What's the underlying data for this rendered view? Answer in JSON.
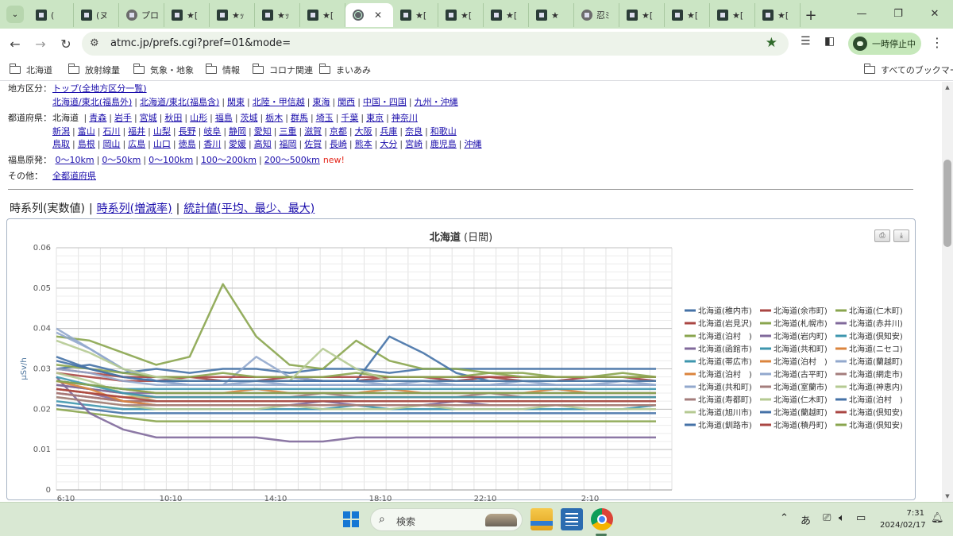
{
  "browser": {
    "tabs": [
      {
        "label": "(",
        "icon": "site-favicon"
      },
      {
        "label": "(ヌ",
        "icon": "site-favicon"
      },
      {
        "label": "プロ",
        "icon": "site-favicon"
      },
      {
        "label": "★[",
        "icon": "site-favicon"
      },
      {
        "label": "★ｯ",
        "icon": "site-favicon"
      },
      {
        "label": "★ｯ",
        "icon": "site-favicon"
      },
      {
        "label": "★[",
        "icon": "site-favicon"
      },
      {
        "label": "",
        "icon": "globe-icon",
        "active": true
      },
      {
        "label": "★[",
        "icon": "site-favicon"
      },
      {
        "label": "★[",
        "icon": "site-favicon"
      },
      {
        "label": "★[",
        "icon": "site-favicon"
      },
      {
        "label": "★",
        "icon": "site-favicon"
      },
      {
        "label": "忍ﾐ",
        "icon": "site-favicon"
      },
      {
        "label": "★[",
        "icon": "site-favicon"
      },
      {
        "label": "★[",
        "icon": "site-favicon"
      },
      {
        "label": "★[",
        "icon": "site-favicon"
      },
      {
        "label": "★[",
        "icon": "site-favicon"
      }
    ],
    "url": "atmc.jp/prefs.cgi?pref=01&mode=",
    "pause_label": "一時停止中",
    "bookmarks": [
      "北海道",
      "放射線量",
      "気象・地象",
      "情報",
      "コロナ関連",
      "まいあみ"
    ],
    "all_bookmarks": "すべてのブックマーク"
  },
  "nav": {
    "region_label": "地方区分：",
    "region_top": "トップ(全地方区分一覧)",
    "regions": [
      "北海道/東北(福島外)",
      "北海道/東北(福島含)",
      "関東",
      "北陸・甲信越",
      "東海",
      "関西",
      "中国・四国",
      "九州・沖縄"
    ],
    "pref_label": "都道府県：",
    "pref_current": "北海道",
    "prefs_row1": [
      "青森",
      "岩手",
      "宮城",
      "秋田",
      "山形",
      "福島",
      "茨城",
      "栃木",
      "群馬",
      "埼玉",
      "千葉",
      "東京",
      "神奈川"
    ],
    "prefs_row2": [
      "新潟",
      "富山",
      "石川",
      "福井",
      "山梨",
      "長野",
      "岐阜",
      "静岡",
      "愛知",
      "三重",
      "滋賀",
      "京都",
      "大阪",
      "兵庫",
      "奈良",
      "和歌山"
    ],
    "prefs_row3": [
      "鳥取",
      "島根",
      "岡山",
      "広島",
      "山口",
      "徳島",
      "香川",
      "愛媛",
      "高知",
      "福岡",
      "佐賀",
      "長崎",
      "熊本",
      "大分",
      "宮崎",
      "鹿児島",
      "沖縄"
    ],
    "fukushima_label": "福島原発：",
    "fukushima": [
      "0～10km",
      "0～50km",
      "0～100km",
      "100～200km",
      "200～500km"
    ],
    "new_badge": "new!",
    "other_label": "その他：",
    "other": "全都道府県"
  },
  "modes": {
    "current": "時系列(実数値)",
    "links": [
      "時系列(増減率)",
      "統計値(平均、最少、最大)"
    ]
  },
  "chart_data": {
    "type": "line",
    "title": "北海道",
    "subtitle": "(日間)",
    "ylabel": "μSv/h",
    "ylim": [
      0,
      0.06
    ],
    "yticks": [
      "0",
      "0.01",
      "0.02",
      "0.03",
      "0.04",
      "0.05",
      "0.06"
    ],
    "xticks": [
      "6:10",
      "10:10",
      "14:10",
      "18:10",
      "22:10",
      "2:10"
    ],
    "grid": true,
    "legend_position": "right",
    "colors": [
      "#4572A7",
      "#AA4643",
      "#89A54E",
      "#80699B",
      "#3D96AE",
      "#DB843D",
      "#92A8CD",
      "#A47D7C",
      "#B5CA92"
    ],
    "series": [
      {
        "name": "北海道(稚内市)",
        "values": [
          0.03,
          0.031,
          0.029,
          0.03,
          0.029,
          0.03,
          0.03,
          0.029,
          0.03,
          0.03,
          0.029,
          0.03,
          0.03,
          0.03,
          0.03,
          0.03,
          0.03,
          0.03,
          0.03
        ]
      },
      {
        "name": "北海道(岩見沢)",
        "values": [
          0.029,
          0.028,
          0.027,
          0.027,
          0.028,
          0.027,
          0.027,
          0.028,
          0.027,
          0.027,
          0.028,
          0.028,
          0.027,
          0.028,
          0.027,
          0.027,
          0.028,
          0.028,
          0.027
        ]
      },
      {
        "name": "北海道(泊村　)",
        "values": [
          0.038,
          0.037,
          0.034,
          0.031,
          0.033,
          0.051,
          0.038,
          0.031,
          0.03,
          0.037,
          0.032,
          0.03,
          0.03,
          0.029,
          0.029,
          0.028,
          0.028,
          0.029,
          0.028
        ]
      },
      {
        "name": "北海道(函館市)",
        "values": [
          0.025,
          0.024,
          0.022,
          0.021,
          0.021,
          0.021,
          0.021,
          0.021,
          0.022,
          0.021,
          0.021,
          0.021,
          0.022,
          0.021,
          0.021,
          0.021,
          0.021,
          0.021,
          0.021
        ]
      },
      {
        "name": "北海道(帯広市)",
        "values": [
          0.022,
          0.021,
          0.02,
          0.02,
          0.02,
          0.02,
          0.02,
          0.02,
          0.02,
          0.021,
          0.02,
          0.02,
          0.02,
          0.02,
          0.02,
          0.02,
          0.02,
          0.02,
          0.021
        ]
      },
      {
        "name": "北海道(泊村　)",
        "values": [
          0.027,
          0.026,
          0.025,
          0.024,
          0.024,
          0.024,
          0.025,
          0.024,
          0.024,
          0.024,
          0.025,
          0.024,
          0.024,
          0.024,
          0.024,
          0.025,
          0.024,
          0.024,
          0.024
        ]
      },
      {
        "name": "北海道(共和町)",
        "values": [
          0.04,
          0.035,
          0.03,
          0.027,
          0.026,
          0.026,
          0.033,
          0.028,
          0.027,
          0.027,
          0.026,
          0.027,
          0.026,
          0.026,
          0.027,
          0.026,
          0.026,
          0.027,
          0.026
        ]
      },
      {
        "name": "北海道(寿都町)",
        "values": [
          0.026,
          0.025,
          0.024,
          0.023,
          0.023,
          0.023,
          0.023,
          0.023,
          0.024,
          0.023,
          0.023,
          0.023,
          0.023,
          0.024,
          0.023,
          0.023,
          0.023,
          0.023,
          0.023
        ]
      },
      {
        "name": "北海道(旭川市)",
        "values": [
          0.023,
          0.022,
          0.021,
          0.02,
          0.02,
          0.02,
          0.02,
          0.021,
          0.02,
          0.02,
          0.02,
          0.021,
          0.02,
          0.02,
          0.02,
          0.021,
          0.02,
          0.02,
          0.02
        ]
      },
      {
        "name": "北海道(釧路市)",
        "values": [
          0.021,
          0.02,
          0.019,
          0.019,
          0.019,
          0.019,
          0.019,
          0.019,
          0.019,
          0.019,
          0.019,
          0.019,
          0.019,
          0.019,
          0.019,
          0.019,
          0.019,
          0.019,
          0.019
        ]
      },
      {
        "name": "北海道(余市町)",
        "values": [
          0.024,
          0.023,
          0.022,
          0.022,
          0.022,
          0.022,
          0.022,
          0.022,
          0.022,
          0.022,
          0.022,
          0.022,
          0.022,
          0.022,
          0.022,
          0.022,
          0.022,
          0.022,
          0.022
        ]
      },
      {
        "name": "北海道(札幌市)",
        "values": [
          0.02,
          0.019,
          0.018,
          0.017,
          0.017,
          0.017,
          0.017,
          0.017,
          0.017,
          0.017,
          0.017,
          0.017,
          0.017,
          0.017,
          0.017,
          0.017,
          0.017,
          0.017,
          0.017
        ]
      },
      {
        "name": "北海道(岩内町)",
        "values": [
          0.028,
          0.019,
          0.015,
          0.013,
          0.013,
          0.013,
          0.013,
          0.012,
          0.012,
          0.013,
          0.013,
          0.013,
          0.013,
          0.013,
          0.013,
          0.013,
          0.013,
          0.013,
          0.013
        ]
      },
      {
        "name": "北海道(共和町)",
        "values": [
          0.027,
          0.026,
          0.025,
          0.025,
          0.025,
          0.025,
          0.025,
          0.025,
          0.025,
          0.025,
          0.025,
          0.025,
          0.025,
          0.025,
          0.025,
          0.025,
          0.025,
          0.025,
          0.025
        ]
      },
      {
        "name": "北海道(泊村　)",
        "values": [
          0.025,
          0.024,
          0.023,
          0.023,
          0.023,
          0.023,
          0.023,
          0.023,
          0.023,
          0.023,
          0.023,
          0.023,
          0.023,
          0.023,
          0.023,
          0.023,
          0.023,
          0.023,
          0.023
        ]
      },
      {
        "name": "北海道(古平町)",
        "values": [
          0.039,
          0.035,
          0.03,
          0.027,
          0.026,
          0.026,
          0.027,
          0.026,
          0.026,
          0.026,
          0.026,
          0.026,
          0.026,
          0.026,
          0.026,
          0.026,
          0.026,
          0.026,
          0.026
        ]
      },
      {
        "name": "北海道(室蘭市)",
        "values": [
          0.024,
          0.023,
          0.022,
          0.022,
          0.022,
          0.022,
          0.022,
          0.022,
          0.022,
          0.022,
          0.022,
          0.022,
          0.022,
          0.022,
          0.022,
          0.022,
          0.022,
          0.022,
          0.022
        ]
      },
      {
        "name": "北海道(仁木町)",
        "values": [
          0.029,
          0.027,
          0.024,
          0.022,
          0.022,
          0.022,
          0.022,
          0.022,
          0.022,
          0.022,
          0.022,
          0.022,
          0.022,
          0.022,
          0.022,
          0.022,
          0.022,
          0.022,
          0.022
        ]
      },
      {
        "name": "北海道(蘭越町)",
        "values": [
          0.033,
          0.03,
          0.028,
          0.027,
          0.027,
          0.027,
          0.027,
          0.027,
          0.027,
          0.027,
          0.038,
          0.034,
          0.029,
          0.027,
          0.027,
          0.027,
          0.027,
          0.027,
          0.027
        ]
      },
      {
        "name": "北海道(積丹町)",
        "values": [
          0.03,
          0.029,
          0.028,
          0.028,
          0.028,
          0.028,
          0.028,
          0.028,
          0.028,
          0.028,
          0.028,
          0.028,
          0.028,
          0.028,
          0.028,
          0.028,
          0.028,
          0.028,
          0.028
        ]
      },
      {
        "name": "北海道(仁木町)",
        "values": [
          0.031,
          0.03,
          0.029,
          0.028,
          0.028,
          0.029,
          0.028,
          0.028,
          0.028,
          0.029,
          0.028,
          0.028,
          0.028,
          0.029,
          0.028,
          0.028,
          0.028,
          0.028,
          0.028
        ]
      },
      {
        "name": "北海道(赤井川)",
        "values": [
          0.026,
          0.025,
          0.024,
          0.024,
          0.024,
          0.024,
          0.024,
          0.024,
          0.024,
          0.024,
          0.024,
          0.024,
          0.024,
          0.024,
          0.024,
          0.024,
          0.024,
          0.024,
          0.024
        ]
      },
      {
        "name": "北海道(倶知安)",
        "values": [
          0.028,
          0.026,
          0.024,
          0.023,
          0.023,
          0.023,
          0.023,
          0.023,
          0.023,
          0.023,
          0.023,
          0.023,
          0.023,
          0.023,
          0.023,
          0.023,
          0.023,
          0.023,
          0.023
        ]
      },
      {
        "name": "北海道(ニセコ)",
        "values": [
          0.027,
          0.025,
          0.022,
          0.021,
          0.021,
          0.021,
          0.021,
          0.021,
          0.021,
          0.021,
          0.021,
          0.021,
          0.021,
          0.021,
          0.021,
          0.021,
          0.021,
          0.021,
          0.021
        ]
      },
      {
        "name": "北海道(蘭越町)",
        "values": [
          0.03,
          0.029,
          0.027,
          0.026,
          0.026,
          0.026,
          0.026,
          0.026,
          0.026,
          0.026,
          0.026,
          0.026,
          0.026,
          0.026,
          0.026,
          0.026,
          0.026,
          0.026,
          0.026
        ]
      },
      {
        "name": "北海道(網走市)",
        "values": [
          0.023,
          0.022,
          0.021,
          0.021,
          0.021,
          0.021,
          0.021,
          0.021,
          0.021,
          0.021,
          0.021,
          0.021,
          0.021,
          0.021,
          0.021,
          0.021,
          0.021,
          0.021,
          0.021
        ]
      },
      {
        "name": "北海道(神恵内)",
        "values": [
          0.037,
          0.034,
          0.03,
          0.028,
          0.027,
          0.027,
          0.027,
          0.027,
          0.035,
          0.03,
          0.027,
          0.027,
          0.027,
          0.027,
          0.027,
          0.027,
          0.027,
          0.027,
          0.027
        ]
      },
      {
        "name": "北海道(泊村　)",
        "values": [
          0.032,
          0.03,
          0.028,
          0.027,
          0.027,
          0.027,
          0.027,
          0.027,
          0.027,
          0.027,
          0.027,
          0.027,
          0.027,
          0.027,
          0.027,
          0.027,
          0.027,
          0.027,
          0.027
        ]
      },
      {
        "name": "北海道(倶知安)",
        "values": [
          0.025,
          0.024,
          0.023,
          0.022,
          0.022,
          0.022,
          0.022,
          0.022,
          0.022,
          0.022,
          0.022,
          0.022,
          0.022,
          0.022,
          0.022,
          0.022,
          0.022,
          0.022,
          0.022
        ]
      },
      {
        "name": "北海道(倶知安)",
        "values": [
          0.027,
          0.026,
          0.025,
          0.024,
          0.024,
          0.024,
          0.024,
          0.024,
          0.024,
          0.024,
          0.024,
          0.024,
          0.024,
          0.024,
          0.024,
          0.024,
          0.024,
          0.024,
          0.024
        ]
      }
    ]
  },
  "taskbar": {
    "search_placeholder": "検索",
    "ime": "あ",
    "time": "7:31",
    "date": "2024/02/17"
  }
}
